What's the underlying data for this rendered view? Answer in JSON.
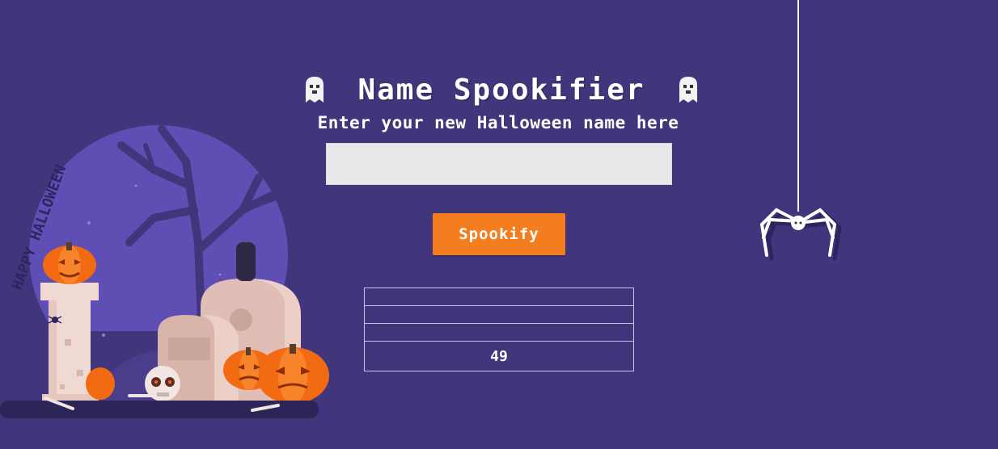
{
  "header": {
    "title": "Name Spookifier",
    "subtitle": "Enter your new Halloween name here"
  },
  "form": {
    "name_value": "",
    "name_placeholder": "",
    "button_label": "Spookify"
  },
  "results": {
    "rows": [
      "",
      "",
      "",
      "49"
    ]
  },
  "illustration": {
    "banner_text": "HAPPY HALLOWEEN"
  },
  "colors": {
    "background": "#41357b",
    "button": "#f47d1f",
    "moon": "#5f4fb5",
    "pumpkin": "#f26b12"
  },
  "icons": {
    "left_ghost": "ghost-icon",
    "right_ghost": "ghost-icon",
    "spider": "spider-icon"
  }
}
